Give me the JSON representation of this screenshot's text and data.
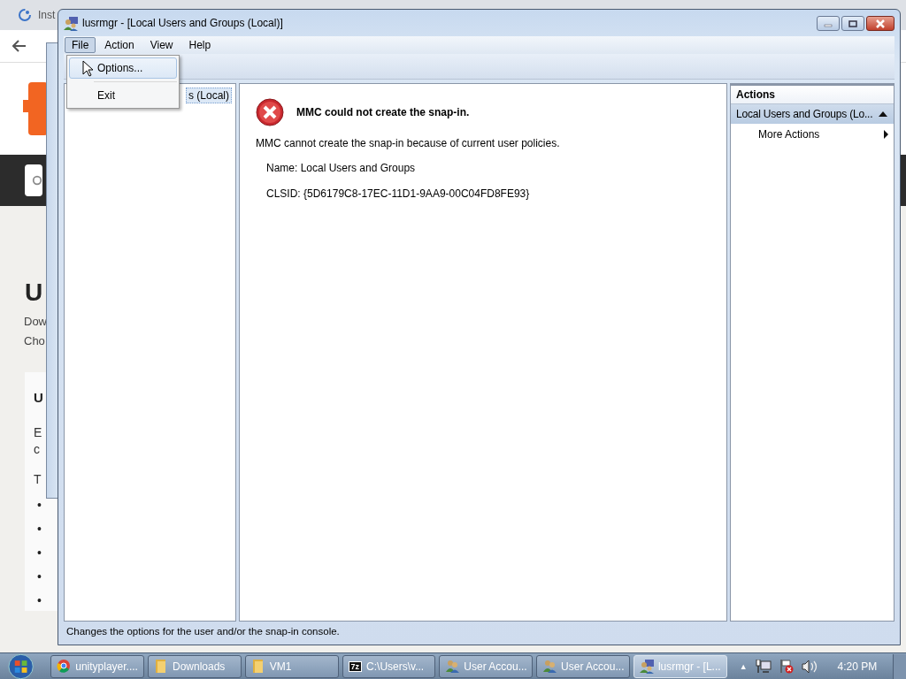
{
  "background_browser": {
    "tab_title": "Inst",
    "heading": "U",
    "text_lines": [
      "Dow",
      "Cho"
    ],
    "card": {
      "heading": "U",
      "text_lines": [
        "E",
        "c"
      ],
      "intro": "T",
      "bullets": [
        "•",
        "•",
        "•",
        "•",
        "•"
      ]
    }
  },
  "window": {
    "title": "lusrmgr - [Local Users and Groups (Local)]",
    "menu": [
      {
        "label": "File",
        "open": true
      },
      {
        "label": "Action",
        "open": false
      },
      {
        "label": "View",
        "open": false
      },
      {
        "label": "Help",
        "open": false
      }
    ],
    "file_menu": [
      {
        "label": "Options...",
        "selected": true
      },
      {
        "label": "Exit",
        "selected": false
      }
    ],
    "tree": [
      {
        "label": "s (Local)",
        "selected": true
      }
    ],
    "error": {
      "title": "MMC could not create the snap-in.",
      "message": "MMC cannot create the snap-in because of current user policies.",
      "details": [
        "Name: Local Users and Groups",
        "CLSID: {5D6179C8-17EC-11D1-9AA9-00C04FD8FE93}"
      ]
    },
    "actions": {
      "title": "Actions",
      "sections": [
        {
          "label": "Local Users and Groups (Lo...",
          "expanded": true,
          "items": [
            {
              "label": "More Actions",
              "submenu": true
            }
          ]
        }
      ]
    },
    "status_bar": "Changes the options for the user and/or the snap-in console."
  },
  "taskbar": {
    "buttons": [
      {
        "label": "unityplayer....",
        "kind": "browser",
        "active": false
      },
      {
        "label": "Downloads",
        "kind": "folder",
        "active": false
      },
      {
        "label": "VM1",
        "kind": "folder",
        "active": false
      },
      {
        "label": "C:\\Users\\v...",
        "kind": "archive",
        "icon_text": "7z",
        "active": false
      },
      {
        "label": "User Accou...",
        "kind": "users",
        "active": false
      },
      {
        "label": "User Accou...",
        "kind": "users",
        "active": false
      },
      {
        "label": "lusrmgr - [L...",
        "kind": "mmc",
        "active": true
      }
    ],
    "show_hidden": "▲",
    "clock": "4:20 PM"
  }
}
